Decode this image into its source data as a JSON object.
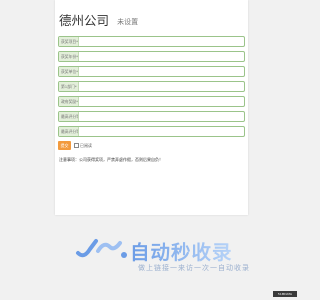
{
  "header": {
    "title": "德州公司",
    "subtitle": "未设置"
  },
  "form": {
    "fields": [
      {
        "label": "获奖项目*",
        "value": ""
      },
      {
        "label": "获奖年份*",
        "value": ""
      },
      {
        "label": "获奖单位*",
        "value": ""
      },
      {
        "label": "第1部门*",
        "value": ""
      },
      {
        "label": "政府奖励*",
        "value": ""
      },
      {
        "label": "最高评分等级*",
        "value": ""
      },
      {
        "label": "最高评分等级*",
        "value": ""
      }
    ],
    "submit_label": "提交",
    "checkbox_label": "已阅读"
  },
  "note": "注意事项：公司获得奖项，严禁弄虚作假，否则后果自负！",
  "logo": {
    "text": "自动秒收录",
    "subtitle": "做上链接一来访一次一自动收录"
  },
  "badge": "51MDATA"
}
